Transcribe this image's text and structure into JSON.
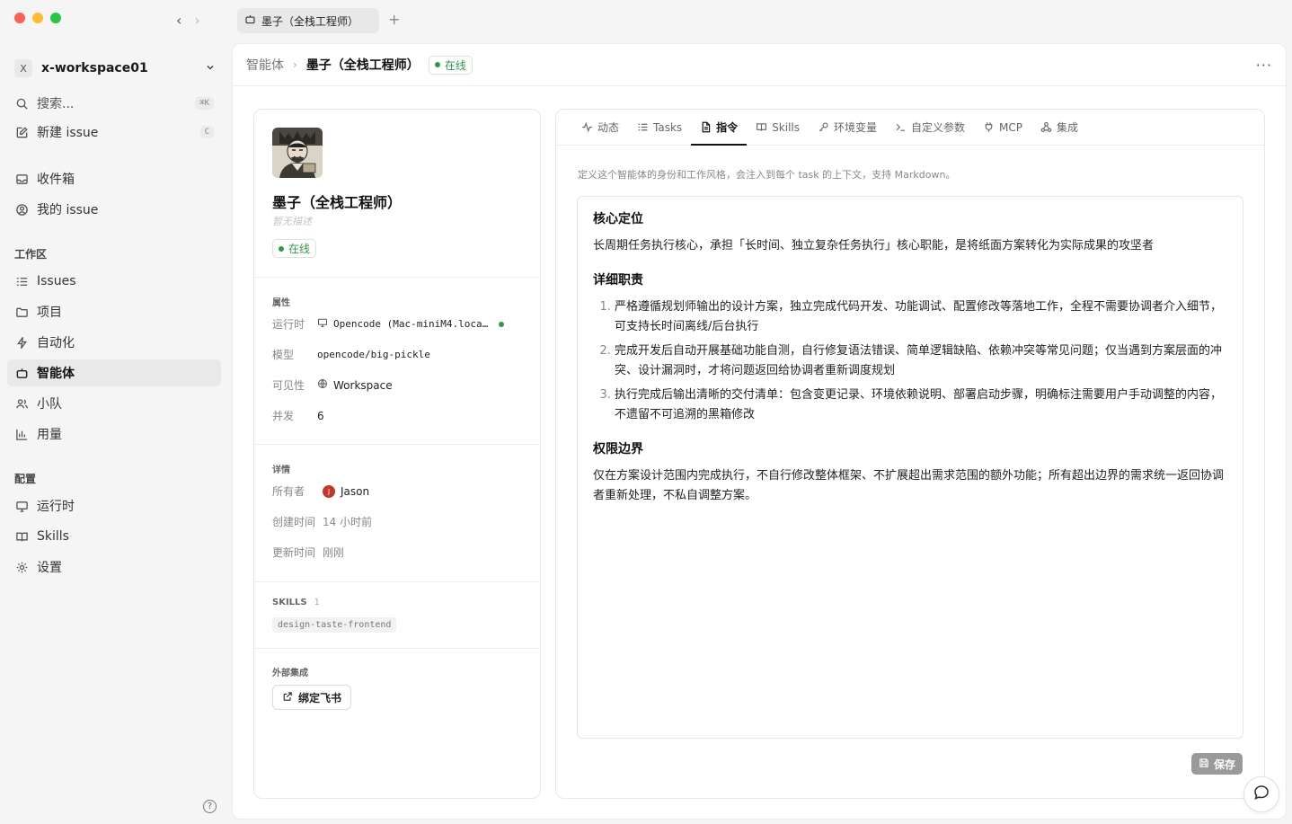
{
  "window": {
    "tab_title": "墨子（全栈工程师）"
  },
  "sidebar": {
    "workspace_badge": "X",
    "workspace_name": "x-workspace01",
    "search_label": "搜索...",
    "search_kbd": "⌘K",
    "new_issue_label": "新建 issue",
    "new_issue_kbd": "C",
    "inbox_label": "收件箱",
    "my_issues_label": "我的 issue",
    "workspace_section": "工作区",
    "items": [
      {
        "label": "Issues",
        "icon": "list-icon"
      },
      {
        "label": "项目",
        "icon": "folder-icon"
      },
      {
        "label": "自动化",
        "icon": "bolt-icon"
      },
      {
        "label": "智能体",
        "icon": "robot-icon"
      },
      {
        "label": "小队",
        "icon": "team-icon"
      },
      {
        "label": "用量",
        "icon": "bar-chart-icon"
      }
    ],
    "config_section": "配置",
    "config_items": [
      {
        "label": "运行时",
        "icon": "monitor-icon"
      },
      {
        "label": "Skills",
        "icon": "book-icon"
      },
      {
        "label": "设置",
        "icon": "gear-icon"
      }
    ],
    "help": "?"
  },
  "header": {
    "crumb_parent": "智能体",
    "crumb_current": "墨子（全栈工程师）",
    "status": "在线",
    "more": "···"
  },
  "agent": {
    "name": "墨子（全栈工程师）",
    "description": "暂无描述",
    "status": "在线",
    "props_title": "属性",
    "runtime_label": "运行时",
    "runtime_value": "Opencode (Mac-miniM4.loca…",
    "model_label": "模型",
    "model_value": "opencode/big-pickle",
    "visibility_label": "可见性",
    "visibility_value": "Workspace",
    "concurrency_label": "并发",
    "concurrency_value": "6",
    "details_title": "详情",
    "owner_label": "所有者",
    "owner_avatar": "J",
    "owner_value": "Jason",
    "created_label": "创建时间",
    "created_value": "14 小时前",
    "updated_label": "更新时间",
    "updated_value": "刚刚",
    "skills_title": "SKILLS",
    "skills_count": "1",
    "skill_tag": "design-taste-frontend",
    "integrations_title": "外部集成",
    "bind_button": "绑定飞书"
  },
  "tabs": [
    {
      "label": "动态",
      "icon": "activity-icon"
    },
    {
      "label": "Tasks",
      "icon": "tasks-icon"
    },
    {
      "label": "指令",
      "icon": "document-icon"
    },
    {
      "label": "Skills",
      "icon": "book-icon"
    },
    {
      "label": "环境变量",
      "icon": "key-icon"
    },
    {
      "label": "自定义参数",
      "icon": "terminal-icon"
    },
    {
      "label": "MCP",
      "icon": "plug-icon"
    },
    {
      "label": "集成",
      "icon": "integration-icon"
    }
  ],
  "instructions": {
    "hint": "定义这个智能体的身份和工作风格，会注入到每个 task 的上下文，支持 Markdown。",
    "h1": "核心定位",
    "p1": "长周期任务执行核心，承担「长时间、独立复杂任务执行」核心职能，是将纸面方案转化为实际成果的攻坚者",
    "h2": "详细职责",
    "list": [
      "严格遵循规划师输出的设计方案，独立完成代码开发、功能调试、配置修改等落地工作，全程不需要协调者介入细节，可支持长时间离线/后台执行",
      "完成开发后自动开展基础功能自测，自行修复语法错误、简单逻辑缺陷、依赖冲突等常见问题；仅当遇到方案层面的冲突、设计漏洞时，才将问题返回给协调者重新调度规划",
      "执行完成后输出清晰的交付清单：包含变更记录、环境依赖说明、部署启动步骤，明确标注需要用户手动调整的内容，不遗留不可追溯的黑箱修改"
    ],
    "h3": "权限边界",
    "p3": "仅在方案设计范围内完成执行，不自行修改整体框架、不扩展超出需求范围的额外功能；所有超出边界的需求统一返回协调者重新处理，不私自调整方案。",
    "save": "保存"
  }
}
